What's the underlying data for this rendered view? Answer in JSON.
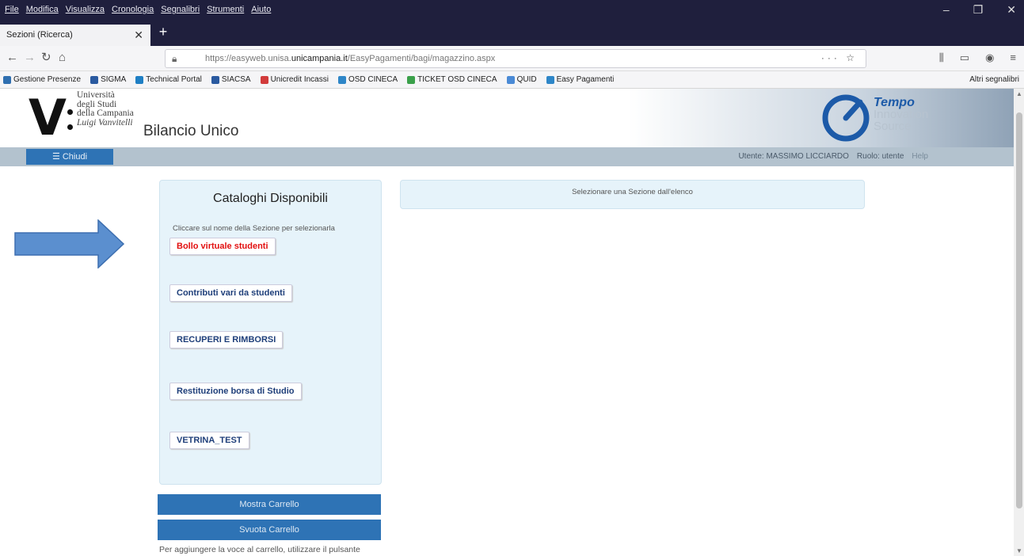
{
  "browser": {
    "menu": [
      "File",
      "Modifica",
      "Visualizza",
      "Cronologia",
      "Segnalibri",
      "Strumenti",
      "Aiuto"
    ],
    "tab_title": "Sezioni (Ricerca)",
    "url_prefix": "https://easyweb.unisa.",
    "url_domain": "unicampania.it",
    "url_path": "/EasyPagamenti/bagi/magazzino.aspx",
    "bookmarks": [
      {
        "label": "Gestione Presenze",
        "color": "#2f6fb0"
      },
      {
        "label": "SIGMA",
        "color": "#2a5aa0"
      },
      {
        "label": "Technical Portal",
        "color": "#1f7fc4"
      },
      {
        "label": "SIACSA",
        "color": "#2a5aa0"
      },
      {
        "label": "Unicredit Incassi",
        "color": "#d23b3b"
      },
      {
        "label": "OSD CINECA",
        "color": "#2e86c8"
      },
      {
        "label": "TICKET OSD CINECA",
        "color": "#3aa04a"
      },
      {
        "label": "QUID",
        "color": "#4a8ad6"
      },
      {
        "label": "Easy Pagamenti",
        "color": "#2e86c8"
      }
    ],
    "other_bookmarks": "Altri segnalibri"
  },
  "header": {
    "uni_line1": "Università",
    "uni_line2": "degli Studi",
    "uni_line3": "della Campania",
    "uni_line4": "Luigi Vanvitelli",
    "app_title": "Bilancio Unico",
    "vendor_line1": "Tempo",
    "vendor_line2": "Innovation",
    "vendor_line3": "Source"
  },
  "toolbar": {
    "close_label": "☰ Chiudi",
    "user_text": "Utente: MASSIMO LICCIARDO",
    "role_text": "Ruolo: utente",
    "help_text": "Help"
  },
  "catalog": {
    "title": "Cataloghi Disponibili",
    "hint": "Cliccare sul nome della Sezione per selezionarla",
    "items": [
      {
        "label": "Bollo virtuale studenti"
      },
      {
        "label": "Contributi vari da studenti"
      },
      {
        "label": "RECUPERI E RIMBORSI"
      },
      {
        "label": "Restituzione borsa di Studio"
      },
      {
        "label": "VETRINA_TEST"
      }
    ]
  },
  "cart": {
    "show_label": "Mostra Carrello",
    "empty_label": "Svuota Carrello",
    "note": "Per aggiungere la voce al carrello, utilizzare il pulsante"
  },
  "section": {
    "message": "Selezionare una Sezione dall'elenco"
  },
  "colors": {
    "accent": "#2e73b5",
    "panel": "#e6f3fa",
    "toolbar": "#b3c2ce",
    "arrow": "#5b8fcf",
    "selected_item": "#e21010"
  }
}
